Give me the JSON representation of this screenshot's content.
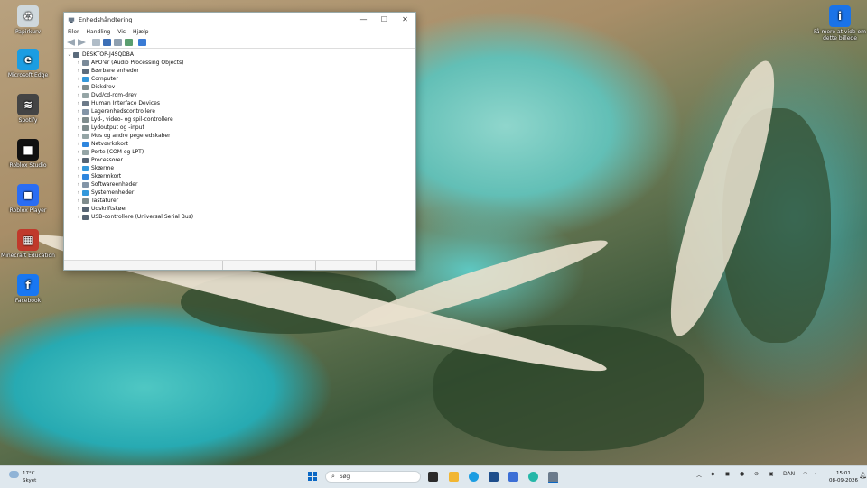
{
  "desktop": {
    "icons": [
      {
        "label": "Papirkurv",
        "icon": "recycle-bin-icon",
        "color": "#cfd8dc"
      },
      {
        "label": "Microsoft Edge",
        "icon": "edge-icon",
        "color": "#1b9de2"
      },
      {
        "label": "Spotify",
        "icon": "spotify-icon",
        "color": "#444"
      },
      {
        "label": "Roblox Studio",
        "icon": "roblox-studio-icon",
        "color": "#111"
      },
      {
        "label": "Roblox Player",
        "icon": "roblox-player-icon",
        "color": "#2a6df4"
      },
      {
        "label": "Minecraft Education",
        "icon": "minecraft-icon",
        "color": "#c0392b"
      },
      {
        "label": "Facebook",
        "icon": "facebook-icon",
        "color": "#1877f2"
      }
    ],
    "spotlight": {
      "label": "Få mere at vide om dette billede",
      "icon": "spotlight-info-icon"
    }
  },
  "window": {
    "title": "Enhedshåndtering",
    "controls": {
      "minimize": "—",
      "maximize": "☐",
      "close": "✕"
    },
    "menu": [
      "Filer",
      "Handling",
      "Vis",
      "Hjælp"
    ],
    "tree": {
      "root": "DESKTOP-J4SQDBA",
      "items": [
        {
          "label": "APO'er (Audio Processing Objects)",
          "color": "#7a8a99"
        },
        {
          "label": "Bærbare enheder",
          "color": "#5d6d7e"
        },
        {
          "label": "Computer",
          "color": "#3498db"
        },
        {
          "label": "Diskdrev",
          "color": "#7f8c8d"
        },
        {
          "label": "Dvd/cd-rom-drev",
          "color": "#95a5a6"
        },
        {
          "label": "Human Interface Devices",
          "color": "#6c7a89"
        },
        {
          "label": "Lagerenhedscontrollere",
          "color": "#8395a7"
        },
        {
          "label": "Lyd-, video- og spil-controllere",
          "color": "#7f8c8d"
        },
        {
          "label": "Lydoutput og -input",
          "color": "#7f8c8d"
        },
        {
          "label": "Mus og andre pegeredskaber",
          "color": "#95a5a6"
        },
        {
          "label": "Netværkskort",
          "color": "#2e86de"
        },
        {
          "label": "Porte (COM og LPT)",
          "color": "#95a5a6"
        },
        {
          "label": "Processorer",
          "color": "#576574"
        },
        {
          "label": "Skærme",
          "color": "#3498db"
        },
        {
          "label": "Skærmkort",
          "color": "#2e86de"
        },
        {
          "label": "Softwareenheder",
          "color": "#8395a7"
        },
        {
          "label": "Systemenheder",
          "color": "#3498db"
        },
        {
          "label": "Tastaturer",
          "color": "#7f8c8d"
        },
        {
          "label": "Udskriftskøer",
          "color": "#576574"
        },
        {
          "label": "USB-controllere (Universal Serial Bus)",
          "color": "#576574"
        }
      ]
    }
  },
  "taskbar": {
    "weather": {
      "temp": "17°C",
      "desc": "Skyet"
    },
    "search_placeholder": "Søg",
    "language": "DAN",
    "time": "15:01",
    "date": "08-09-2026"
  },
  "colors": {
    "accent": "#0a67c4",
    "taskbar_bg": "#dfe8ee"
  }
}
